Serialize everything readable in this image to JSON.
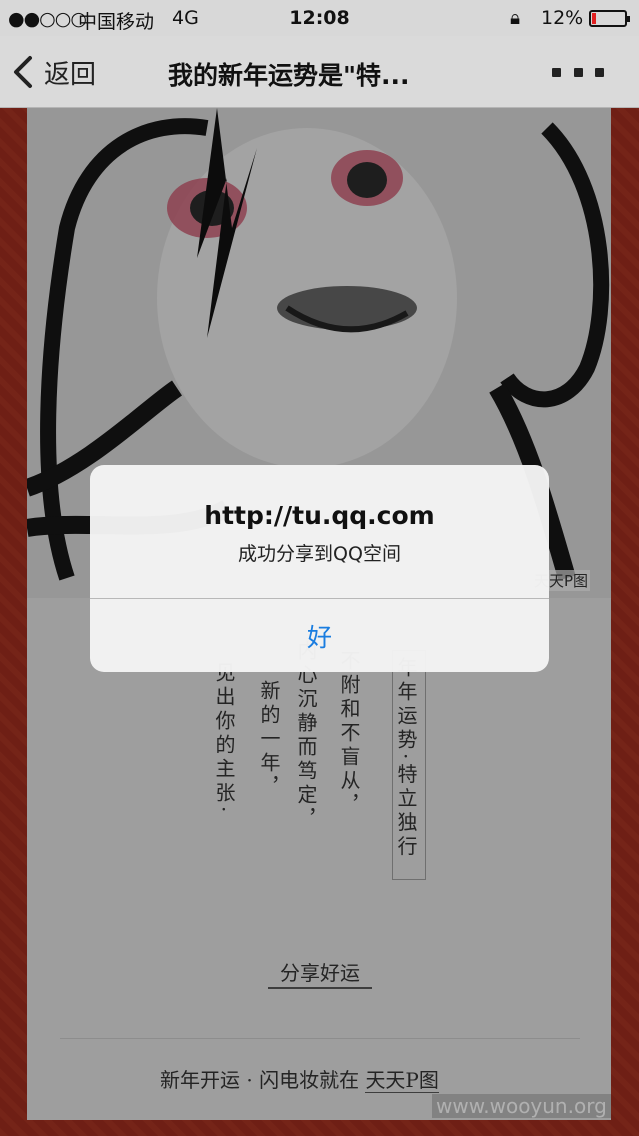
{
  "status_bar": {
    "signal": "●●○○○",
    "carrier": "中国移动",
    "network": "4G",
    "time": "12:08",
    "battery_percent": "12%",
    "battery_level": 0.12
  },
  "nav": {
    "back_label": "返回",
    "title": "我的新年运势是\"特...",
    "more_icon": "ellipsis-icon"
  },
  "photo": {
    "watermark": "天天P图"
  },
  "poem": {
    "lines": [
      "见出你的主张·",
      "新的一年，",
      "内心沉静而笃定，",
      "不附和不盲从，"
    ],
    "tag": "年年运势·特立独行"
  },
  "share_label": "分享好运",
  "footer": {
    "text": "新年开运 · 闪电妆就在",
    "brand": "天天P图"
  },
  "site_url": "www.wooyun.org",
  "alert": {
    "title": "http://tu.qq.com",
    "message": "成功分享到QQ空间",
    "ok_label": "好"
  },
  "colors": {
    "alert_button": "#1a7de0",
    "frame_red": "#9a2b1e",
    "battery_low": "#e02020"
  }
}
